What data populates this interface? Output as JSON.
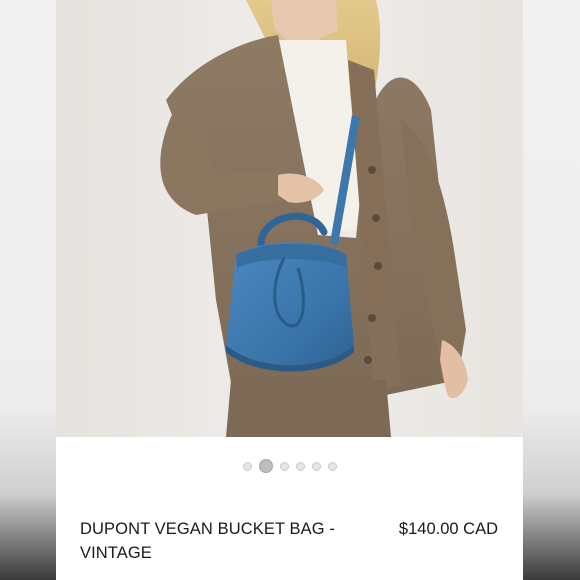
{
  "product": {
    "title": "DUPONT VEGAN BUCKET BAG - VINTAGE",
    "price": "$140.00 CAD",
    "image_description_icon": "product-photo"
  },
  "carousel": {
    "dot_count": 6,
    "active_index": 1
  },
  "colors": {
    "bag": "#3f7bb0",
    "cardigan": "#8a7560",
    "background": "#ece9e6"
  }
}
